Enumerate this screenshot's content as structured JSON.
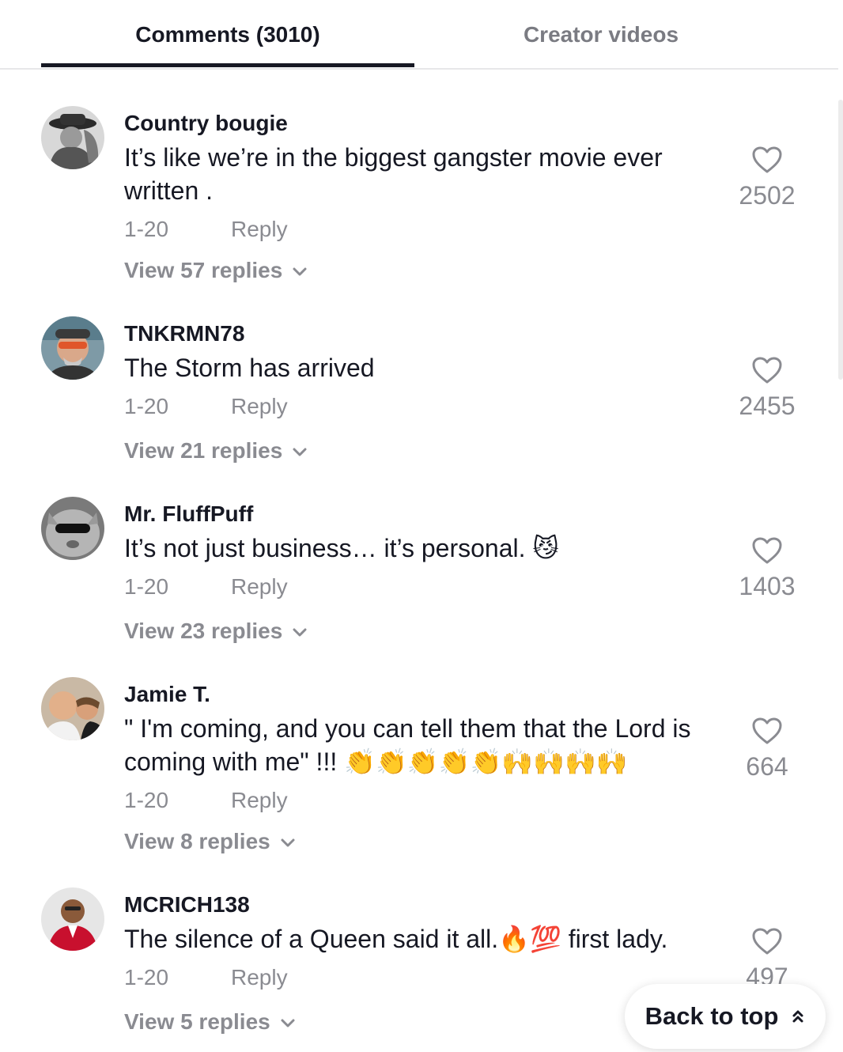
{
  "tabs": [
    {
      "label": "Comments (3010)"
    },
    {
      "label": "Creator videos"
    }
  ],
  "comments": [
    {
      "username": "Country bougie",
      "text": "It’s like we’re in the biggest gangster movie ever written .",
      "date": "1-20",
      "reply_label": "Reply",
      "view_replies": "View 57 replies",
      "likes": "2502"
    },
    {
      "username": "TNKRMN78",
      "text": "The Storm has arrived",
      "date": "1-20",
      "reply_label": "Reply",
      "view_replies": "View 21 replies",
      "likes": "2455"
    },
    {
      "username": "Mr. FluffPuff",
      "text": "It’s not just business… it’s personal. 😼",
      "date": "1-20",
      "reply_label": "Reply",
      "view_replies": "View 23 replies",
      "likes": "1403"
    },
    {
      "username": "Jamie  T.",
      "text": "\" I'm coming, and you can tell them that the Lord is coming with me\" !!! 👏👏👏👏👏🙌🙌🙌🙌",
      "date": "1-20",
      "reply_label": "Reply",
      "view_replies": "View 8 replies",
      "likes": "664"
    },
    {
      "username": "MCRICH138",
      "text": "The silence of a Queen said it all.🔥💯  first lady.",
      "date": "1-20",
      "reply_label": "Reply",
      "view_replies": "View 5 replies",
      "likes": "497"
    }
  ],
  "back_to_top": {
    "label": "Back to top"
  },
  "icons": {
    "like": "heart-outline-icon",
    "expand": "chevron-down-icon",
    "back_to_top": "double-chevron-up-icon"
  },
  "colors": {
    "text_primary": "#161823",
    "text_secondary": "#8a8b91",
    "divider": "#e7e7e9"
  }
}
